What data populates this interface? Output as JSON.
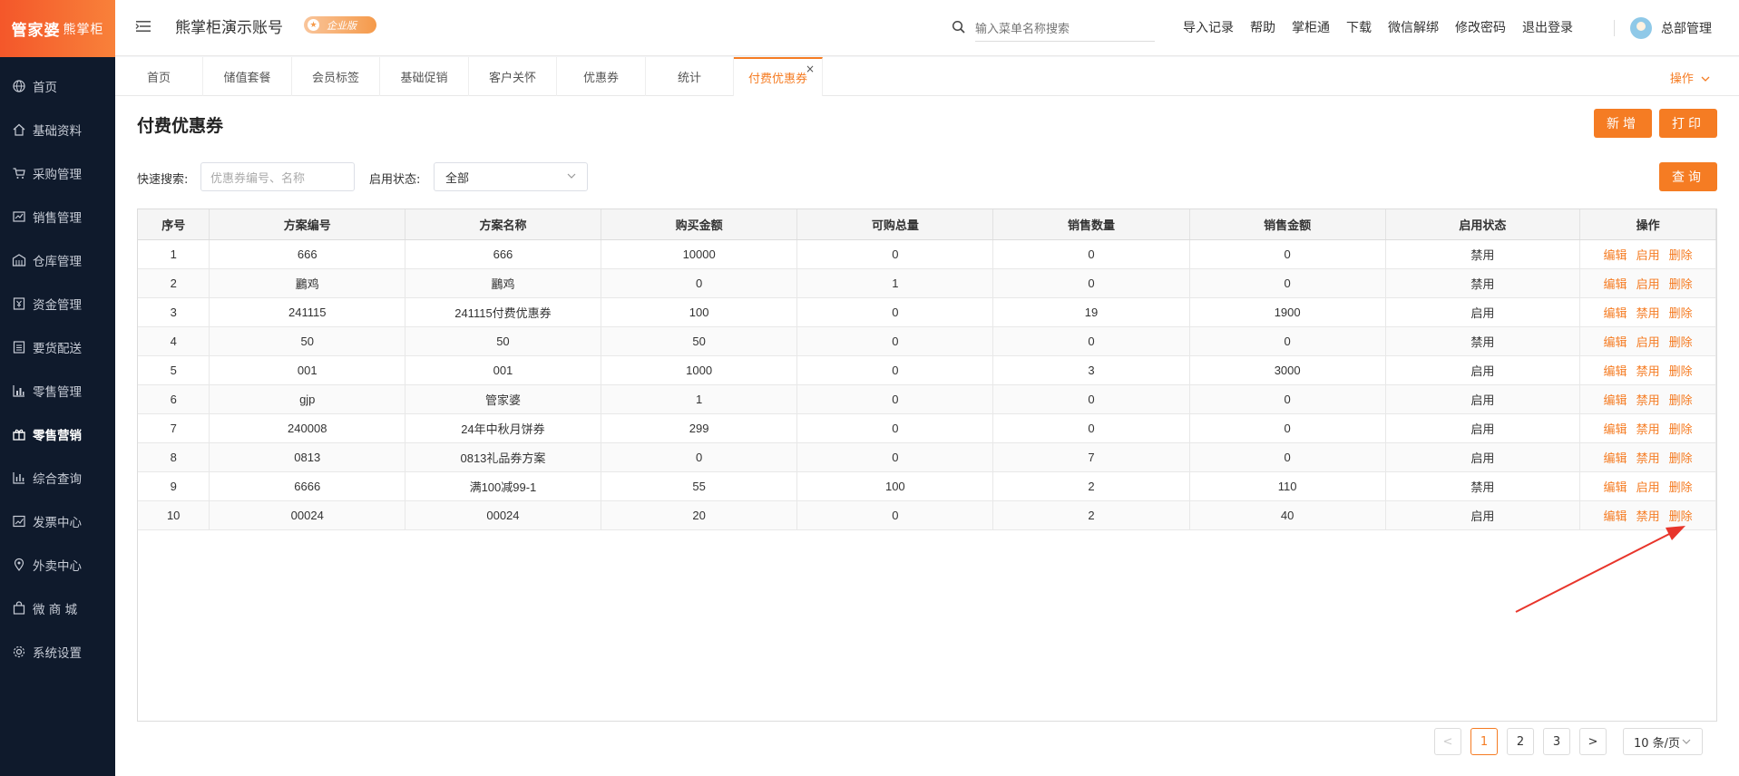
{
  "brand": {
    "name": "管家婆",
    "sub": "熊掌柜"
  },
  "sidebar": {
    "items": [
      {
        "label": "首页",
        "icon": "globe-icon"
      },
      {
        "label": "基础资料",
        "icon": "home-icon"
      },
      {
        "label": "采购管理",
        "icon": "cart-icon"
      },
      {
        "label": "销售管理",
        "icon": "sales-icon"
      },
      {
        "label": "仓库管理",
        "icon": "warehouse-icon"
      },
      {
        "label": "资金管理",
        "icon": "money-icon"
      },
      {
        "label": "要货配送",
        "icon": "list-icon"
      },
      {
        "label": "零售管理",
        "icon": "chart-icon"
      },
      {
        "label": "零售营销",
        "icon": "gift-icon"
      },
      {
        "label": "综合查询",
        "icon": "bar-chart-icon"
      },
      {
        "label": "发票中心",
        "icon": "trend-icon"
      },
      {
        "label": "外卖中心",
        "icon": "location-icon"
      },
      {
        "label": "微 商 城",
        "icon": "bag-icon"
      },
      {
        "label": "系统设置",
        "icon": "gear-icon"
      }
    ]
  },
  "header": {
    "account_title": "熊掌柜演示账号",
    "edition": "企业版",
    "search_placeholder": "输入菜单名称搜索",
    "links": [
      "导入记录",
      "帮助",
      "掌柜通",
      "下载",
      "微信解绑",
      "修改密码",
      "退出登录"
    ],
    "user": "总部管理"
  },
  "tabs": {
    "items": [
      "首页",
      "储值套餐",
      "会员标签",
      "基础促销",
      "客户关怀",
      "优惠券",
      "统计",
      "付费优惠券"
    ],
    "close_glyph": "×",
    "ops_label": "操作"
  },
  "page": {
    "title": "付费优惠券",
    "add_label": "新增",
    "print_label": "打印",
    "query_label": "查询",
    "quick_search_label": "快速搜索:",
    "quick_search_placeholder": "优惠券编号、名称",
    "status_label": "启用状态:",
    "status_value": "全部"
  },
  "table": {
    "headers": [
      "序号",
      "方案编号",
      "方案名称",
      "购买金额",
      "可购总量",
      "销售数量",
      "销售金额",
      "启用状态",
      "操作"
    ],
    "rows": [
      {
        "seq": "1",
        "code": "666",
        "name": "666",
        "price": "10000",
        "total": "0",
        "sold": "0",
        "amount": "0",
        "status": "禁用",
        "actions": [
          "编辑",
          "启用",
          "删除"
        ]
      },
      {
        "seq": "2",
        "code": "鸝鸡",
        "name": "鸝鸡",
        "price": "0",
        "total": "1",
        "sold": "0",
        "amount": "0",
        "status": "禁用",
        "actions": [
          "编辑",
          "启用",
          "删除"
        ]
      },
      {
        "seq": "3",
        "code": "241115",
        "name": "241115付费优惠券",
        "price": "100",
        "total": "0",
        "sold": "19",
        "amount": "1900",
        "status": "启用",
        "actions": [
          "编辑",
          "禁用",
          "删除"
        ]
      },
      {
        "seq": "4",
        "code": "50",
        "name": "50",
        "price": "50",
        "total": "0",
        "sold": "0",
        "amount": "0",
        "status": "禁用",
        "actions": [
          "编辑",
          "启用",
          "删除"
        ]
      },
      {
        "seq": "5",
        "code": "001",
        "name": "001",
        "price": "1000",
        "total": "0",
        "sold": "3",
        "amount": "3000",
        "status": "启用",
        "actions": [
          "编辑",
          "禁用",
          "删除"
        ]
      },
      {
        "seq": "6",
        "code": "gjp",
        "name": "管家婆",
        "price": "1",
        "total": "0",
        "sold": "0",
        "amount": "0",
        "status": "启用",
        "actions": [
          "编辑",
          "禁用",
          "删除"
        ]
      },
      {
        "seq": "7",
        "code": "240008",
        "name": "24年中秋月饼券",
        "price": "299",
        "total": "0",
        "sold": "0",
        "amount": "0",
        "status": "启用",
        "actions": [
          "编辑",
          "禁用",
          "删除"
        ]
      },
      {
        "seq": "8",
        "code": "0813",
        "name": "0813礼品券方案",
        "price": "0",
        "total": "0",
        "sold": "7",
        "amount": "0",
        "status": "启用",
        "actions": [
          "编辑",
          "禁用",
          "删除"
        ]
      },
      {
        "seq": "9",
        "code": "6666",
        "name": "满100减99-1",
        "price": "55",
        "total": "100",
        "sold": "2",
        "amount": "110",
        "status": "禁用",
        "actions": [
          "编辑",
          "启用",
          "删除"
        ]
      },
      {
        "seq": "10",
        "code": "00024",
        "name": "00024",
        "price": "20",
        "total": "0",
        "sold": "2",
        "amount": "40",
        "status": "启用",
        "actions": [
          "编辑",
          "禁用",
          "删除"
        ]
      }
    ]
  },
  "pagination": {
    "prev": "<",
    "pages": [
      "1",
      "2",
      "3"
    ],
    "current": "1",
    "next": ">",
    "page_size": "10 条/页"
  },
  "colors": {
    "accent": "#f57c23",
    "sidebar_bg": "#0f1a2c",
    "annotation_arrow": "#e8352b"
  }
}
